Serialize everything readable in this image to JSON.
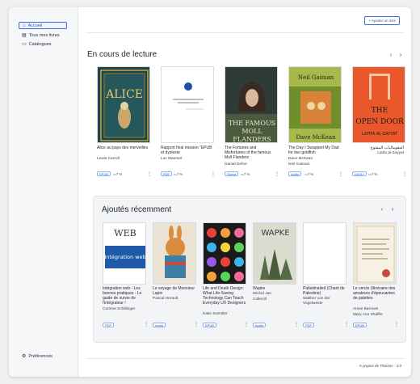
{
  "sidebar": {
    "home": "Accueil",
    "all_books": "Tous mes livres",
    "catalogs": "Catalogues",
    "preferences": "Préférences"
  },
  "header": {
    "add_button": "+ Ajouter un livre"
  },
  "reading": {
    "title": "En cours de lecture",
    "books": [
      {
        "title": "Alice au pays des merveilles",
        "author": "Lewis Carroll",
        "format": "EPUB",
        "progress": "7 %"
      },
      {
        "title": "Rapport final mission \"EPUB et dyslexie",
        "author": "Luc Maumet",
        "format": "PDF",
        "progress": "7 %",
        "cover_text": "Rapport final mission \"EPUB et dyslexie\""
      },
      {
        "title": "The Fortunes and Misfortunes of the famous Moll Flanders",
        "author": "Daniel Defoe",
        "format": "Divina",
        "progress": "7 %",
        "cover_top": "DANIEL DEFOE",
        "cover_title": "THE FAMOUS MOLL FLANDERS"
      },
      {
        "title": "The Day I Swapped My Dad for two goldfish",
        "author": "Dave McKean",
        "author2": "Neil Gaiman",
        "format": "Audio",
        "progress": "7 %",
        "cover_top": "Neil Gaiman",
        "cover_bottom": "Dave McKean"
      },
      {
        "title": "المقوم‏الباب المفتوح",
        "author": "Latifa al-Zayyat",
        "format": "DAISY",
        "progress": "7 %",
        "cover_title": "THE OPEN DOOR",
        "cover_author": "LATIFA AL-ZAYYAT"
      }
    ]
  },
  "recent": {
    "title": "Ajoutés récemment",
    "books": [
      {
        "title": "Intégration web - Les bonnes pratiques - Le guide de survie de l'intégrateur !",
        "author": "Corinne Schillinger",
        "format": "PDF",
        "cover_top": "WEB",
        "cover_title": "Intégration web"
      },
      {
        "title": "Le voyage de Monsieur Lapin",
        "author": "Pascal Hérault",
        "format": "Audio"
      },
      {
        "title": "Life and Death Design: What Life-Saving Technology Can Teach Everyday UX Designers",
        "author": "Katie Swindler",
        "format": "EPUB"
      },
      {
        "title": "Wapke",
        "author": "Michel Jan",
        "author2": "Collectif",
        "format": "Audio",
        "cover_title": "WAPKE"
      },
      {
        "title": "Palästinalied (Chant de Palestine)",
        "author": "Walther von der Vogelweide",
        "format": "PDF"
      },
      {
        "title": "Le cercle (Itinéraire des amateurs d'épouvantes de palettes",
        "author": "Annie Barrows",
        "author2": "Mary Ann Shaffer",
        "format": "EPUB"
      }
    ]
  },
  "footer": {
    "about": "À propos de Thorium - 3.0"
  }
}
